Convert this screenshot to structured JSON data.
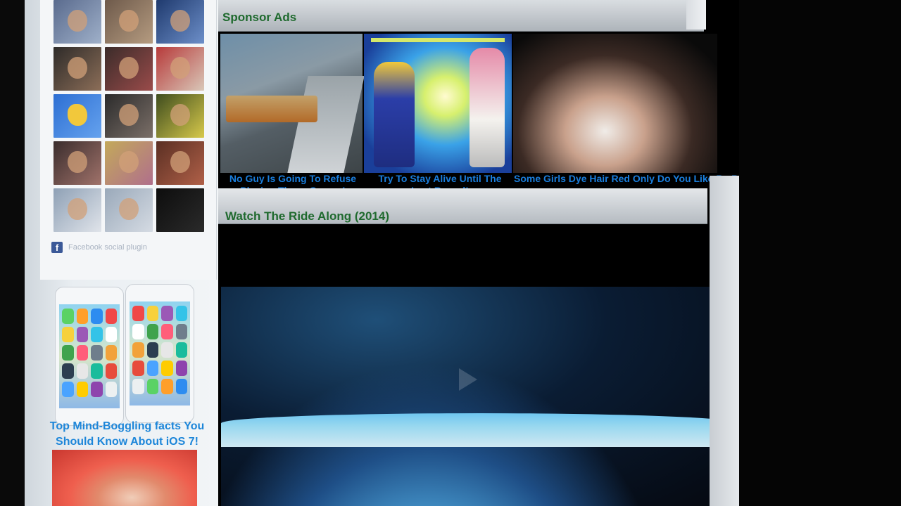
{
  "sidebar": {
    "facebook": {
      "plugin_label": "Facebook social plugin",
      "members": [
        {
          "name": "member-1",
          "tone": "f0"
        },
        {
          "name": "member-2",
          "tone": "f1"
        },
        {
          "name": "member-3",
          "tone": "f2"
        },
        {
          "name": "member-4",
          "tone": "f3"
        },
        {
          "name": "member-5",
          "tone": "f4"
        },
        {
          "name": "member-6",
          "tone": "f5"
        },
        {
          "name": "member-7",
          "tone": "f6"
        },
        {
          "name": "member-8",
          "tone": "f7"
        },
        {
          "name": "member-9",
          "tone": "f8"
        },
        {
          "name": "member-10",
          "tone": "f9"
        },
        {
          "name": "member-11",
          "tone": "f10"
        },
        {
          "name": "member-12",
          "tone": "f11"
        },
        {
          "name": "member-13",
          "tone": "f12"
        },
        {
          "name": "member-14",
          "tone": "f13"
        },
        {
          "name": "member-15",
          "tone": "f14"
        }
      ]
    },
    "ios_ad": {
      "title": "Top Mind-Boggling facts You Should Know About iOS 7!"
    }
  },
  "main": {
    "sponsor_heading": "Sponsor Ads",
    "ads": [
      {
        "caption": "No Guy Is Going To Refuse Playing These Games!"
      },
      {
        "caption": "Try To Stay Alive Until The Last Round!"
      },
      {
        "caption": "Some Girls Dye Hair Red Only Do You Like Re Because They Can't..."
      }
    ],
    "video_heading": "Watch The Ride Along (2014)"
  },
  "colors": {
    "heading_green": "#1f6a2e",
    "link_blue": "#1a7fde",
    "facebook_blue": "#3b5998"
  }
}
